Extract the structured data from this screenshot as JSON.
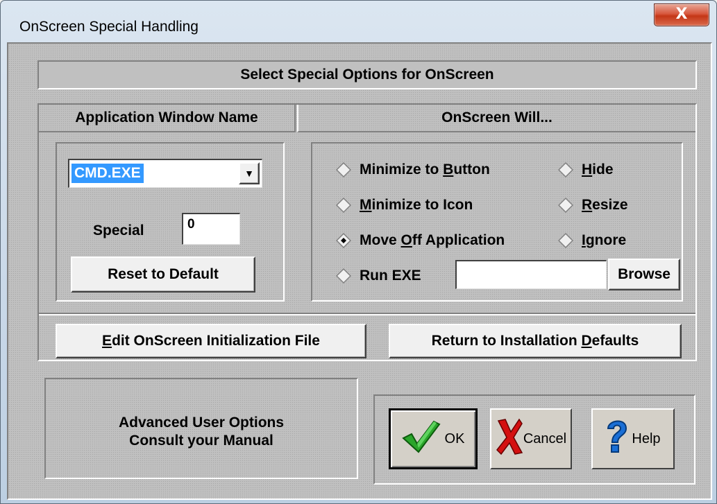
{
  "window": {
    "title": "OnScreen Special Handling",
    "close_label": "X"
  },
  "header": {
    "title": "Select Special Options for OnScreen"
  },
  "left_panel": {
    "heading": "Application Window Name",
    "app_select": {
      "value": "CMD.EXE",
      "arrow": "▼"
    },
    "special": {
      "label": "Special",
      "value": "0"
    },
    "reset_button": "Reset to Default"
  },
  "right_panel": {
    "heading": "OnScreen Will...",
    "options": [
      {
        "pre": "Minimize to ",
        "ul": "B",
        "post": "utton",
        "selected": false
      },
      {
        "pre": "",
        "ul": "H",
        "post": "ide",
        "selected": false
      },
      {
        "pre": "",
        "ul": "M",
        "post": "inimize to Icon",
        "selected": false
      },
      {
        "pre": "",
        "ul": "R",
        "post": "esize",
        "selected": false
      },
      {
        "pre": "Move ",
        "ul": "O",
        "post": "ff Application",
        "selected": true
      },
      {
        "pre": "",
        "ul": "I",
        "post": "gnore",
        "selected": false
      },
      {
        "pre": "Run EXE",
        "ul": "",
        "post": "",
        "selected": false
      }
    ],
    "run_exe_value": "",
    "browse_button": "Browse"
  },
  "actions": {
    "edit_ini": {
      "ul": "E",
      "post": "dit OnScreen Initialization File"
    },
    "return_defaults": {
      "pre": "Return to Installation ",
      "ul": "D",
      "post": "efaults"
    }
  },
  "advanced": {
    "line1": "Advanced User Options",
    "line2": "Consult your Manual"
  },
  "dialog_buttons": {
    "ok": {
      "label": "OK",
      "icon": "checkmark-icon"
    },
    "cancel": {
      "label": "Cancel",
      "icon": "red-x-icon"
    },
    "help": {
      "label": "Help",
      "icon": "question-mark-icon"
    }
  },
  "colors": {
    "selection": "#3399ff",
    "panel": "#c0c0c0",
    "check": "#2aa52a",
    "cancel_x": "#d41010",
    "help_q": "#1a6fd6"
  }
}
